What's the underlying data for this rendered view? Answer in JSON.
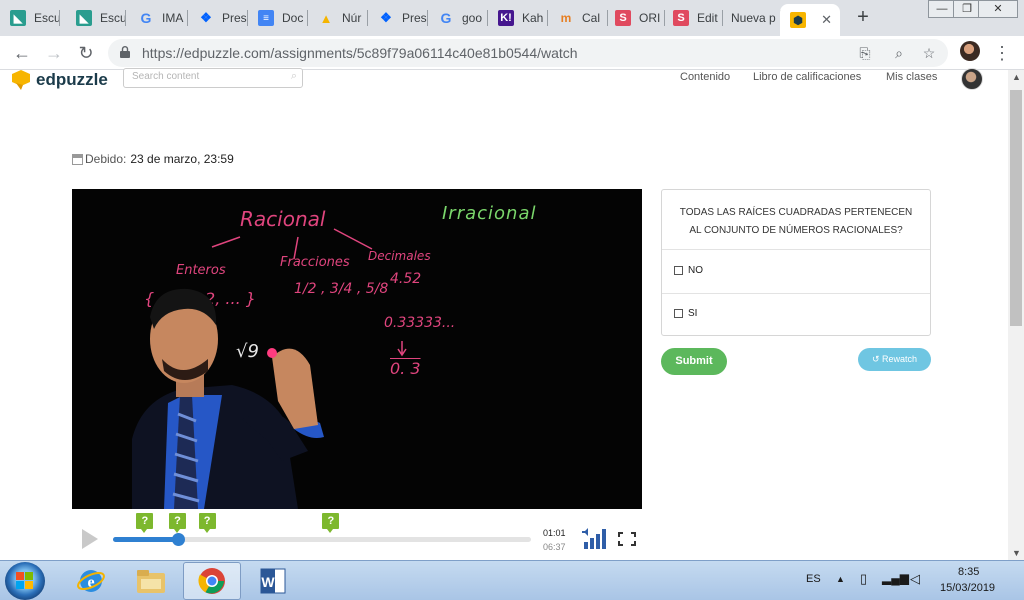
{
  "browser": {
    "tabs": [
      {
        "label": "Escu",
        "icon": "edu-icon",
        "color": "#2a9d8f"
      },
      {
        "label": "Escu",
        "icon": "edu-icon",
        "color": "#2a9d8f"
      },
      {
        "label": "IMA",
        "icon": "google-icon",
        "color": "#4285f4"
      },
      {
        "label": "Pres",
        "icon": "dropbox-icon",
        "color": "#0061fe"
      },
      {
        "label": "Doc",
        "icon": "docs-icon",
        "color": "#4285f4"
      },
      {
        "label": "Núr",
        "icon": "drive-icon",
        "color": "#f4b400"
      },
      {
        "label": "Pres",
        "icon": "dropbox-icon",
        "color": "#0061fe"
      },
      {
        "label": "goo",
        "icon": "google-icon",
        "color": "#4285f4"
      },
      {
        "label": "Kah",
        "icon": "kahoot-icon",
        "color": "#46178f"
      },
      {
        "label": "Cal",
        "icon": "cal-icon",
        "color": "#e67e22"
      },
      {
        "label": "ORI",
        "icon": "s-icon",
        "color": "#e04a5f"
      },
      {
        "label": "Edit",
        "icon": "s-icon",
        "color": "#e04a5f"
      },
      {
        "label": "Nueva p",
        "icon": "",
        "color": ""
      },
      {
        "label": "",
        "icon": "edpuzzle-icon",
        "color": "#f7b500"
      }
    ],
    "url": "https://edpuzzle.com/assignments/5c89f79a06114c40e81b0544/watch"
  },
  "edpuzzle": {
    "logo": "edpuzzle",
    "search_placeholder": "Search content",
    "nav": {
      "contenido": "Contenido",
      "libro": "Libro de calificaciones",
      "clases": "Mis clases"
    }
  },
  "assignment": {
    "due_label": "Debido:",
    "due_value": "23 de marzo, 23:59"
  },
  "board": {
    "racional": "Racional",
    "irracional": "Irracional",
    "enteros": "Enteros",
    "enteros_set": "{ ..., 1, 2, ... }",
    "fracciones": "Fracciones",
    "fracciones_vals": "1/2 , 3/4 , 5/8",
    "decimales": "Decimales",
    "decimal_val": "4.52",
    "repeating": "0.33333...",
    "repeating_bar": "0. 3",
    "sqrt": "√9"
  },
  "player": {
    "current_time": "01:01",
    "total_time": "06:37",
    "progress_fraction": 0.156,
    "question_marker_label": "?",
    "question_marker_fractions": [
      0.075,
      0.153,
      0.224,
      0.52
    ]
  },
  "question": {
    "text": "TODAS LAS RAÍCES CUADRADAS PERTENECEN AL CONJUNTO DE NÚMEROS RACIONALES?",
    "options": [
      "NO",
      "SI"
    ],
    "submit": "Submit",
    "rewatch": "Rewatch"
  },
  "taskbar": {
    "lang": "ES",
    "time": "8:35",
    "date": "15/03/2019"
  },
  "colors": {
    "accent_blue": "#2f80d1",
    "marker_green": "#7db82e",
    "submit_green": "#5cb85c",
    "rewatch_blue": "#6fc6e2",
    "chalk_pink": "#e0457e",
    "chalk_green": "#7ad66b"
  }
}
